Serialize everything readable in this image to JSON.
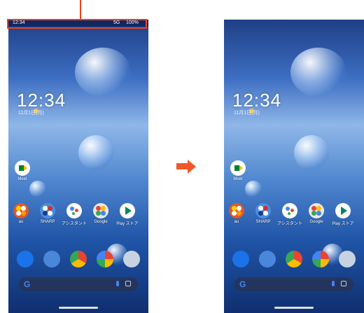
{
  "status_bar": {
    "time": "12:34",
    "network": "5G",
    "battery": "100%"
  },
  "lock": {
    "clock": "12:34",
    "date": "11月1日(月)"
  },
  "apps": {
    "meet": "Meet",
    "row": [
      "au",
      "SHARP",
      "アシスタント",
      "Google",
      "Play ストア"
    ]
  },
  "dock_icons": [
    "phone-icon",
    "messages-icon",
    "chrome-icon",
    "photos-icon",
    "camera-icon"
  ],
  "search": {
    "logo": "G"
  },
  "colors": {
    "accent": "#e8431f",
    "arrow": "#f0582a"
  }
}
